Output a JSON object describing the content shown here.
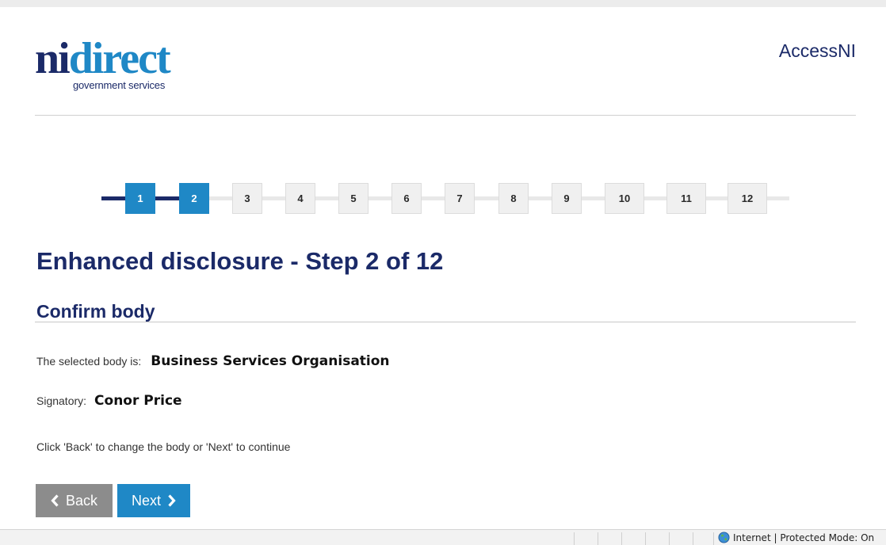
{
  "header": {
    "logo": {
      "part1": "ni",
      "part2": "direct",
      "tagline": "government services"
    },
    "service_name": "AccessNI"
  },
  "stepper": {
    "current_step": 2,
    "total_steps": 12,
    "steps": [
      "1",
      "2",
      "3",
      "4",
      "5",
      "6",
      "7",
      "8",
      "9",
      "10",
      "11",
      "12"
    ]
  },
  "main": {
    "title": "Enhanced disclosure - Step 2 of 12",
    "section_title": "Confirm body",
    "body_label": "The selected body is:",
    "body_value": "Business Services Organisation",
    "signatory_label": "Signatory:",
    "signatory_value": "Conor Price",
    "instructions": "Click 'Back' to change the body or 'Next' to continue"
  },
  "actions": {
    "back_label": "Back",
    "next_label": "Next"
  },
  "statusbar": {
    "zone_text": "Internet | Protected Mode: On"
  },
  "colors": {
    "navy": "#1b2a68",
    "brand_blue": "#1f88c6",
    "back_grey": "#8c8c8c"
  }
}
